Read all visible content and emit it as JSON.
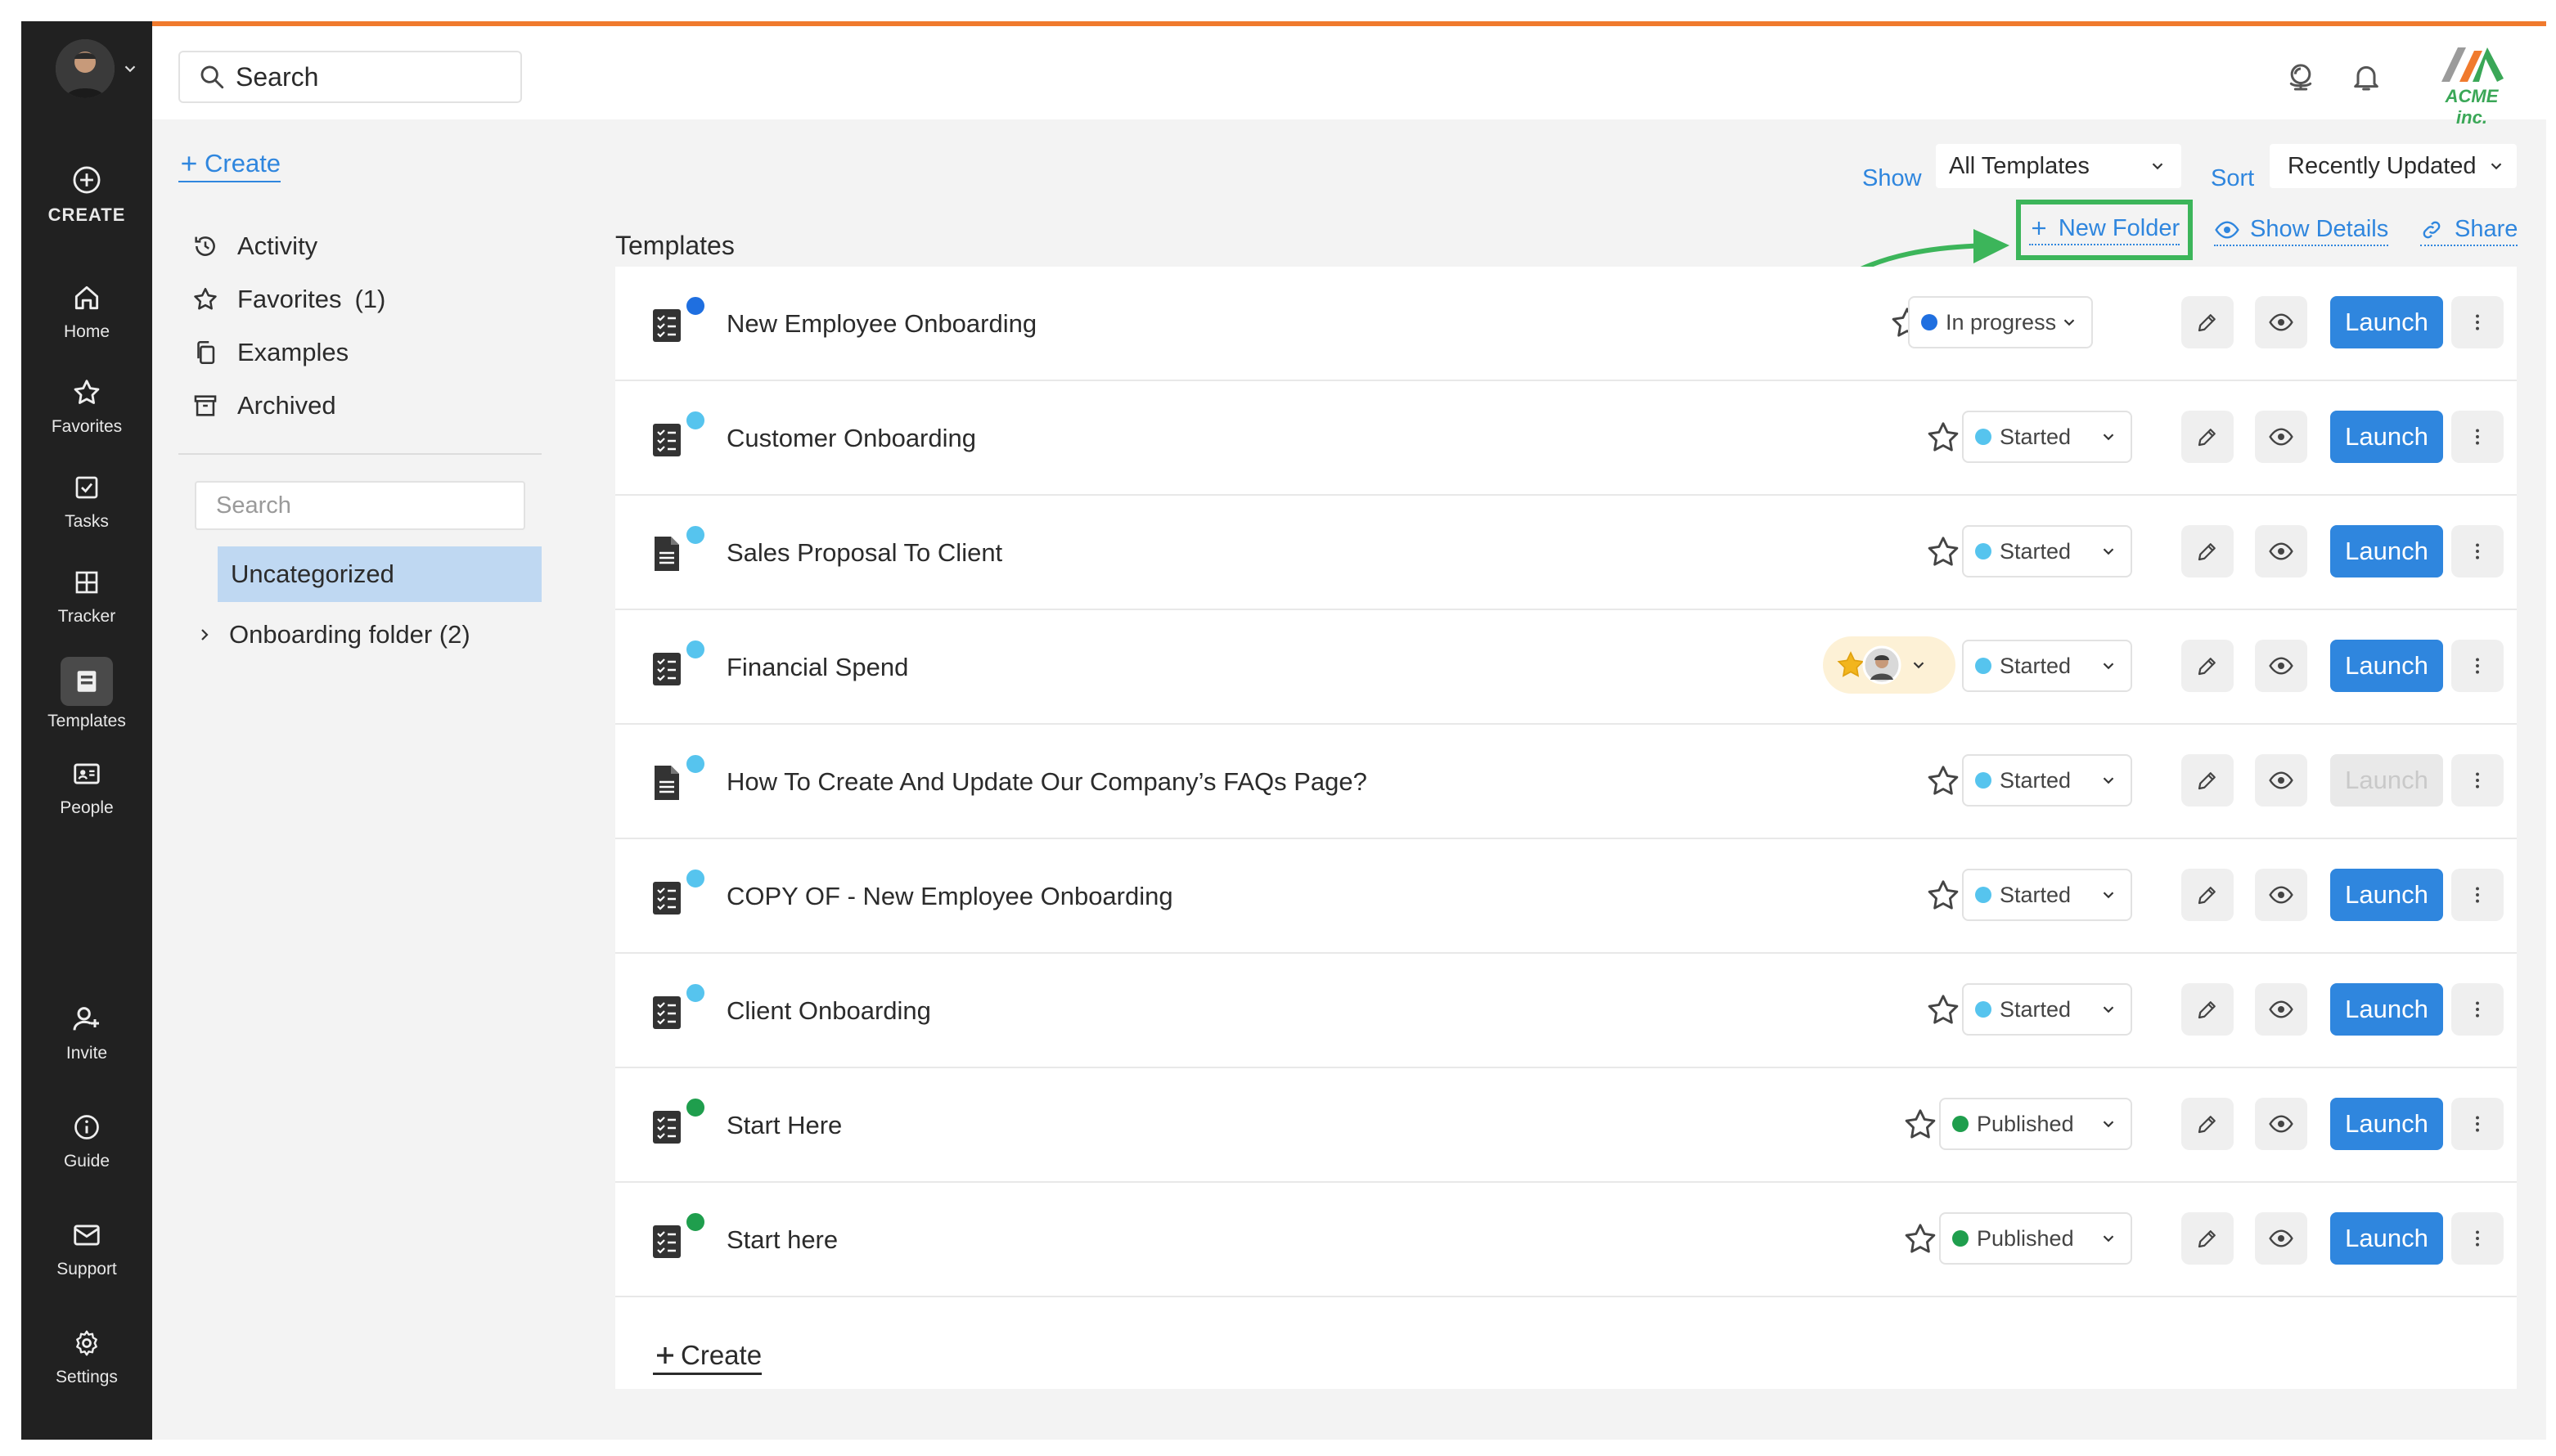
{
  "rail": {
    "create_label": "CREATE",
    "items": [
      {
        "label": "Home",
        "icon": "home-icon"
      },
      {
        "label": "Favorites",
        "icon": "star-icon"
      },
      {
        "label": "Tasks",
        "icon": "checkbox-icon"
      },
      {
        "label": "Tracker",
        "icon": "grid-icon"
      },
      {
        "label": "Templates",
        "icon": "templates-icon",
        "active": true
      },
      {
        "label": "People",
        "icon": "id-card-icon"
      }
    ],
    "bottom_items": [
      {
        "label": "Invite",
        "icon": "add-user-icon"
      },
      {
        "label": "Guide",
        "icon": "info-icon"
      },
      {
        "label": "Support",
        "icon": "mail-icon"
      },
      {
        "label": "Settings",
        "icon": "gear-icon"
      }
    ]
  },
  "header": {
    "search_placeholder": "Search",
    "logo_text": "ACME inc.",
    "colors": {
      "accent_bar": "#f07a2d",
      "brand_green": "#3aa757"
    }
  },
  "left": {
    "create_label": "Create",
    "nav": [
      {
        "label": "Activity",
        "icon": "history-icon"
      },
      {
        "label": "Favorites",
        "count": "(1)",
        "icon": "star-icon"
      },
      {
        "label": "Examples",
        "icon": "copy-icon"
      },
      {
        "label": "Archived",
        "icon": "archive-icon"
      }
    ],
    "folder_search_placeholder": "Search",
    "folders": [
      {
        "label": "Uncategorized",
        "selected": true
      },
      {
        "label": "Onboarding folder (2)",
        "expandable": true
      }
    ]
  },
  "toolbar": {
    "show_label": "Show",
    "show_value": "All Templates",
    "sort_label": "Sort",
    "sort_value": "Recently Updated",
    "section_title": "Templates",
    "new_folder_label": "New Folder",
    "show_details_label": "Show Details",
    "share_label": "Share"
  },
  "templates": [
    {
      "title": "New Employee Onboarding",
      "icon": "checklist-icon",
      "dot": "#1f6fe0",
      "status": "In progress",
      "status_color": "#1f6fe0",
      "launch": "Launch",
      "launch_enabled": true
    },
    {
      "title": "Customer Onboarding",
      "icon": "checklist-icon",
      "dot": "#56c4ee",
      "status": "Started",
      "status_color": "#56c4ee",
      "launch": "Launch",
      "launch_enabled": true
    },
    {
      "title": "Sales Proposal To Client",
      "icon": "document-icon",
      "dot": "#56c4ee",
      "status": "Started",
      "status_color": "#56c4ee",
      "launch": "Launch",
      "launch_enabled": true
    },
    {
      "title": "Financial Spend",
      "icon": "checklist-icon",
      "dot": "#56c4ee",
      "status": "Started",
      "status_color": "#56c4ee",
      "launch": "Launch",
      "launch_enabled": true,
      "has_assignees": true
    },
    {
      "title": "How To Create And Update Our Company’s FAQs Page?",
      "icon": "document-icon",
      "dot": "#56c4ee",
      "status": "Started",
      "status_color": "#56c4ee",
      "launch": "Launch",
      "launch_enabled": false
    },
    {
      "title": "COPY OF - New Employee Onboarding",
      "icon": "checklist-icon",
      "dot": "#56c4ee",
      "status": "Started",
      "status_color": "#56c4ee",
      "launch": "Launch",
      "launch_enabled": true
    },
    {
      "title": "Client Onboarding",
      "icon": "checklist-icon",
      "dot": "#56c4ee",
      "status": "Started",
      "status_color": "#56c4ee",
      "launch": "Launch",
      "launch_enabled": true
    },
    {
      "title": "Start Here",
      "icon": "checklist-icon",
      "dot": "#1f9e4d",
      "status": "Published",
      "status_color": "#1f9e4d",
      "launch": "Launch",
      "launch_enabled": true
    },
    {
      "title": "Start here",
      "icon": "checklist-icon",
      "dot": "#1f9e4d",
      "status": "Published",
      "status_color": "#1f9e4d",
      "launch": "Launch",
      "launch_enabled": true
    }
  ],
  "list_create_label": "Create"
}
